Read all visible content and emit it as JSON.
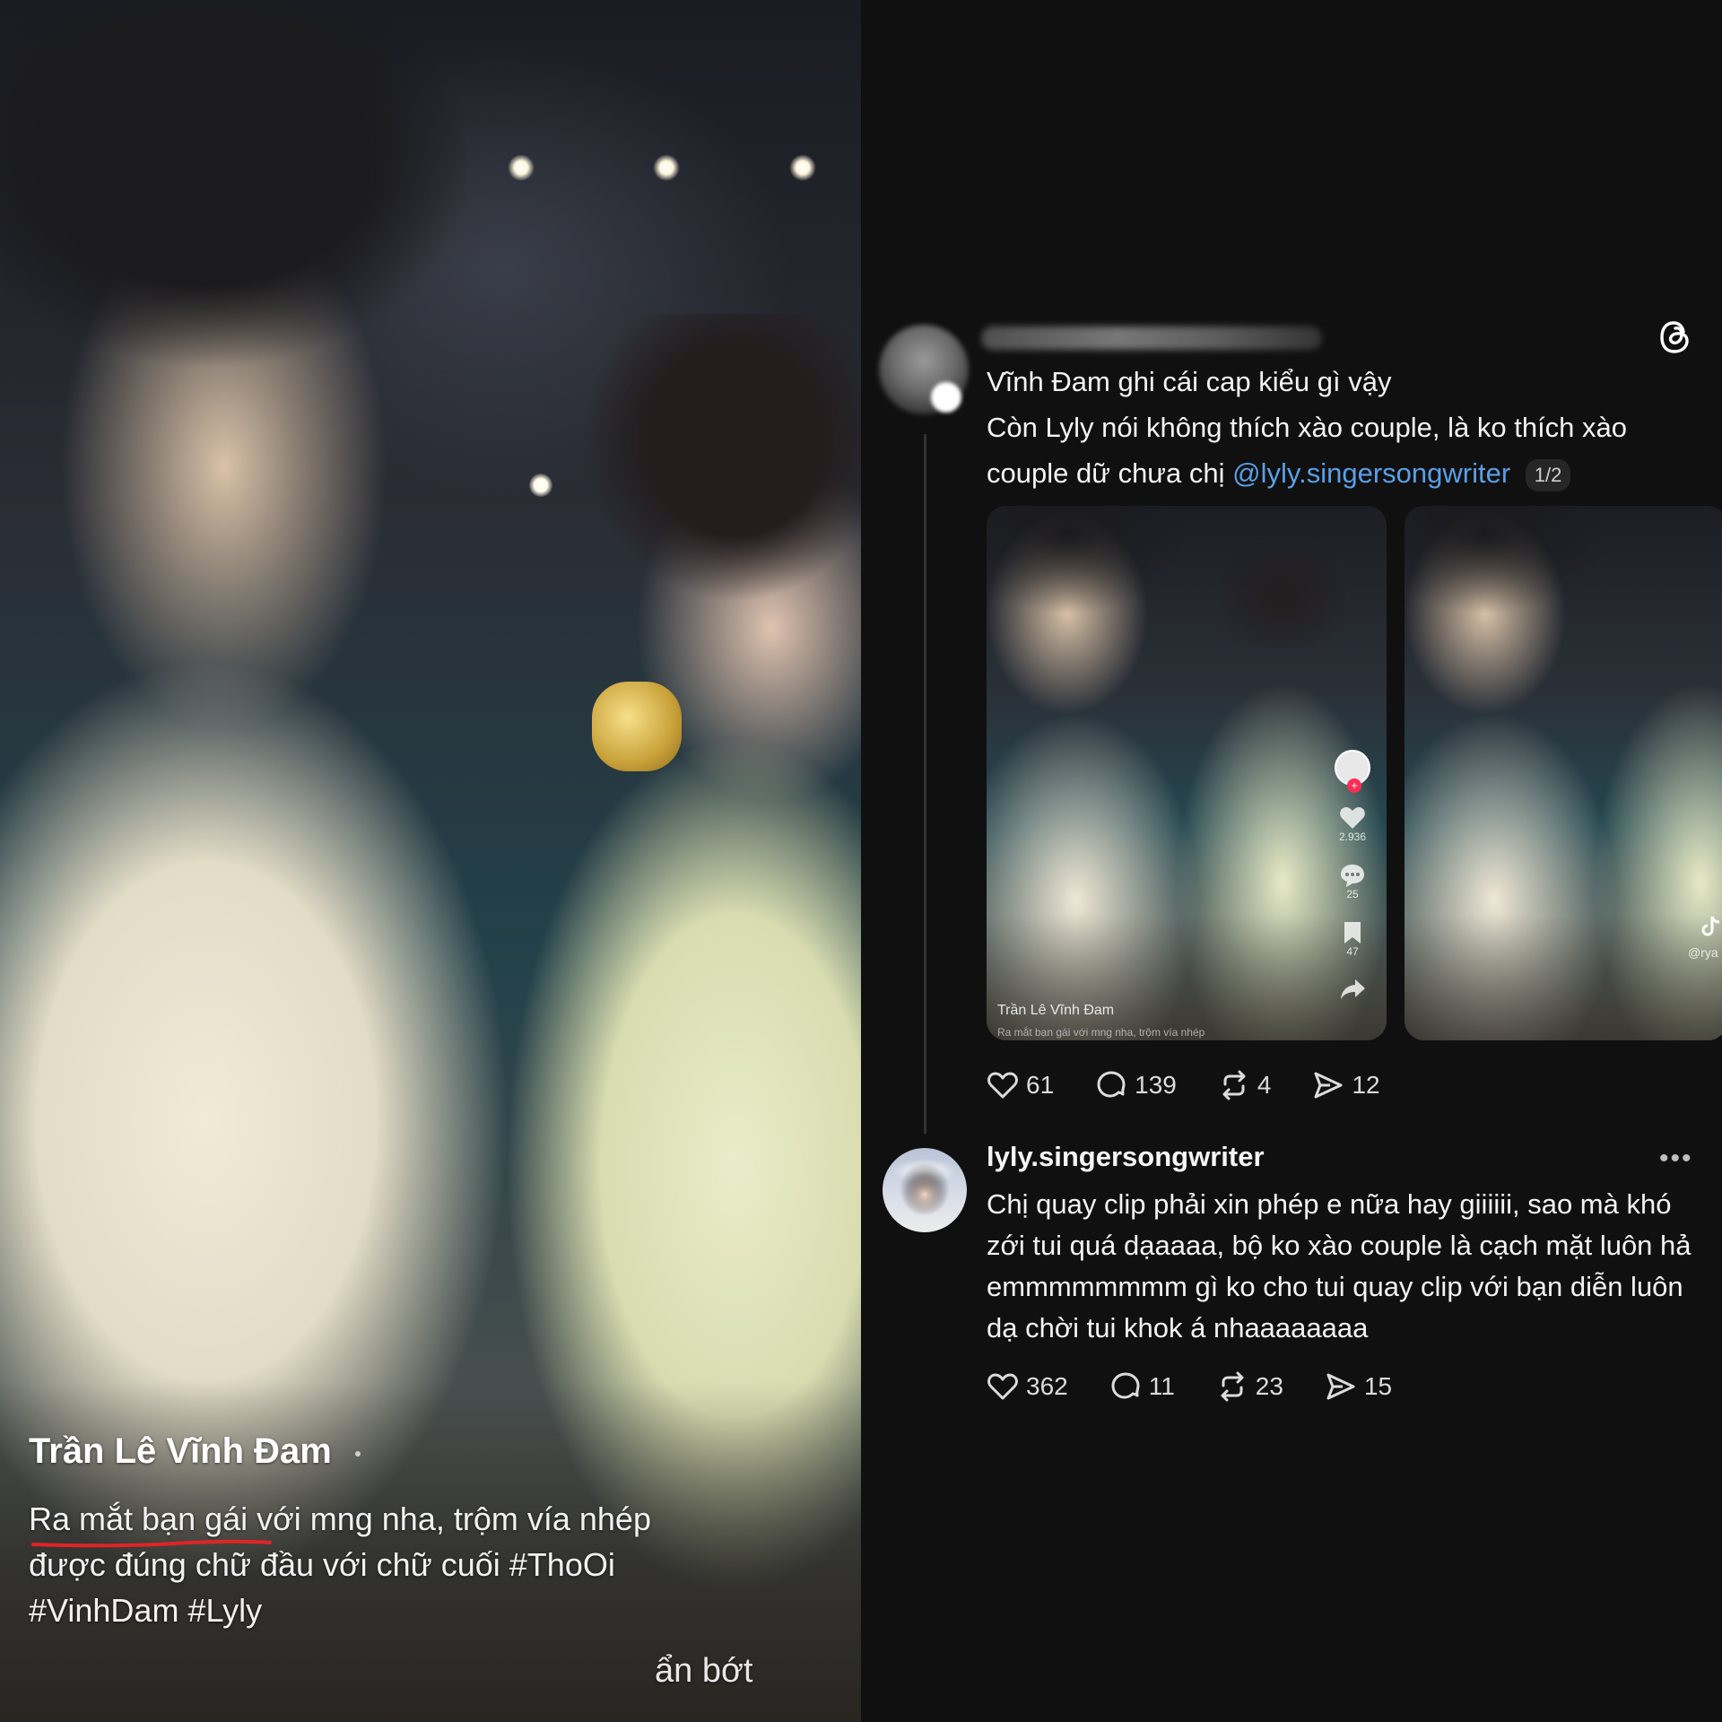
{
  "video": {
    "author": "Trần Lê Vĩnh Đam",
    "caption": "Ra mắt bạn gái với mng nha, trộm vía nhép được đúng chữ đầu với chữ cuối #ThoOi #VinhDam #Lyly",
    "collapse_label": "ẩn bớt",
    "underline_color": "#e02424"
  },
  "thread": {
    "logo_icon": "threads-logo-icon",
    "post": {
      "line1": "Vĩnh Đam ghi cái cap kiểu gì vậy",
      "line2": "Còn Lyly nói không thích xào couple, là ko thích xào couple dữ chưa chị",
      "mention": "@lyly.singersongwriter",
      "media_counter": "1/2",
      "media": [
        {
          "author": "Trần Lê Vĩnh Đam",
          "caption": "Ra mắt bạn gái với mng nha, trộm vía nhép",
          "rail": {
            "likes": "2.936",
            "comments": "25",
            "saves": "47"
          }
        },
        {
          "watermark": "@rya"
        }
      ],
      "stats": {
        "likes": "61",
        "replies": "139",
        "reposts": "4",
        "shares": "12"
      }
    },
    "reply": {
      "username": "lyly.singersongwriter",
      "more_label": "•••",
      "text": "Chị quay clip phải xin phép e nữa hay giiiiii, sao mà khó zới tui quá dạaaaa, bộ ko xào couple là cạch mặt luôn hả emmmmmmmm gì ko cho tui quay clip với bạn diễn luôn dạ chời tui khok á nhaaaaaaaa",
      "stats": {
        "likes": "362",
        "replies": "11",
        "reposts": "23",
        "shares": "15"
      }
    },
    "colors": {
      "mention": "#5b9fe6",
      "background": "#101010",
      "text": "#f3f3f3"
    }
  }
}
